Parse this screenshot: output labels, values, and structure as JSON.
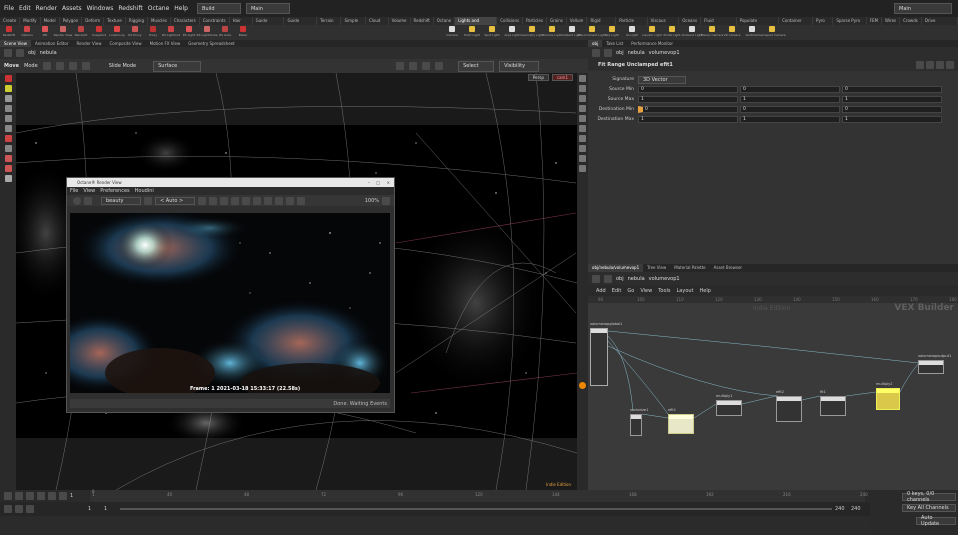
{
  "menubar": {
    "items": [
      "File",
      "Edit",
      "Render",
      "Assets",
      "Windows",
      "Redshift",
      "Octane",
      "Help"
    ],
    "desktop": "Build",
    "context": "Main",
    "right_context": "Main"
  },
  "shelf_tabs": [
    "Create",
    "Modify",
    "Model",
    "Polygon",
    "Deform",
    "Texture",
    "Rigging",
    "Muscles",
    "Characters",
    "Constraints",
    "Hair Utils",
    "Guide Process",
    "Guide Brushes",
    "Terrain FX",
    "Simple FX",
    "Cloud FX",
    "Volume",
    "Redshift",
    "Octane",
    "Lights and Cameras",
    "Collisions",
    "Particles",
    "Grains",
    "Vellum",
    "Rigid Bodies",
    "Particle Fluids",
    "Viscous Fluids",
    "Oceans",
    "Fluid Containers",
    "Populate Containers",
    "Container Tools",
    "Pyro FX",
    "Sparse Pyro FX",
    "FEM",
    "Wires",
    "Crowds",
    "Drive Simulation"
  ],
  "shelf_left_tools": [
    "Redshift",
    "Options",
    "IPR",
    "Render View",
    "RenderIt",
    "Snapshot",
    "LineGroup",
    "RS Proxy",
    "Proxy",
    "RS Lightinst",
    "RS Light",
    "RS Lightdome",
    "RS Area",
    "Baker"
  ],
  "shelf_right_tools": [
    "Camera",
    "Point Light",
    "Spot Light",
    "Area Light",
    "Geometry Light",
    "Volume Light",
    "Distant Light",
    "Environment Light",
    "Sky Light",
    "GI Light",
    "Caustic Light",
    "Portal Light",
    "Ambient Light",
    "Stereo Camera",
    "VR Camera",
    "Switcher",
    "Gamepad Camera"
  ],
  "left_pane_tabs": [
    "Scene View",
    "Animation Editor",
    "Render View",
    "Composite View",
    "Motion FX View",
    "Geometry Spreadsheet"
  ],
  "left_path": {
    "obj": "obj",
    "node": "nebula"
  },
  "viewport_toolbar": {
    "mode_label": "Move",
    "mode": "Mode",
    "state": "Slide Mode",
    "surface": "Surface",
    "select": "Select",
    "visibility": "Visibility",
    "persp": "Persp",
    "cam": "cam1"
  },
  "render_window": {
    "title": "Octane® Render View",
    "menu": [
      "File",
      "View",
      "Preferences",
      "Houdini"
    ],
    "channel": "beauty",
    "camera": "< Auto >",
    "zoom": "100%",
    "frame_text": "Frame: 1  2021-03-18  15:33:17 (22.58s)",
    "status": "Done. Waiting Events"
  },
  "viewport_badge": "Indie Edition",
  "timeline": {
    "ticks": [
      "1",
      "8",
      "40",
      "48",
      "72",
      "96",
      "120",
      "144",
      "168",
      "192",
      "216",
      "240"
    ],
    "frame": "1",
    "start": "1",
    "start2": "1",
    "end": "240",
    "end2": "240"
  },
  "right_bottom": {
    "keys": "0 keys, 0/0 channels",
    "keyall": "Key All Channels",
    "auto": "Auto Update"
  },
  "right_pane_tabs": [
    "obj",
    "Take List",
    "Performance Monitor"
  ],
  "right_path": {
    "obj": "obj",
    "node": "nebula",
    "vop": "volumevop1"
  },
  "params": {
    "header": "Fit Range Unclamped  efit1",
    "signature_label": "Signature",
    "signature_value": "3D Vector",
    "rows": [
      {
        "label": "Source Min",
        "v": [
          "0",
          "0",
          "0"
        ]
      },
      {
        "label": "Source Max",
        "v": [
          "1",
          "1",
          "1"
        ]
      },
      {
        "label": "Destination Min",
        "v": [
          "0",
          "0",
          "0"
        ]
      },
      {
        "label": "Destination Max",
        "v": [
          "1",
          "1",
          "1"
        ]
      }
    ]
  },
  "net_tabs": [
    "obj/nebula/volumevop1",
    "Tree View",
    "Material Palette",
    "Asset Browser"
  ],
  "net_path": {
    "obj": "obj",
    "node": "nebula",
    "vop": "volumevop1"
  },
  "net_menu": [
    "Add",
    "Edit",
    "Go",
    "View",
    "Tools",
    "Layout",
    "Help"
  ],
  "net_badge_small": "Indie Edition",
  "net_badge": "VEX Builder",
  "net_nodes": [
    "volumevopglobal1",
    "vectorize1",
    "efit1",
    "multiply1",
    "efit2",
    "fit1",
    "multiply2",
    "volumevopoutput1"
  ],
  "net_ruler": [
    "90",
    "100",
    "110",
    "120",
    "130",
    "140",
    "150",
    "160",
    "170",
    "180"
  ]
}
